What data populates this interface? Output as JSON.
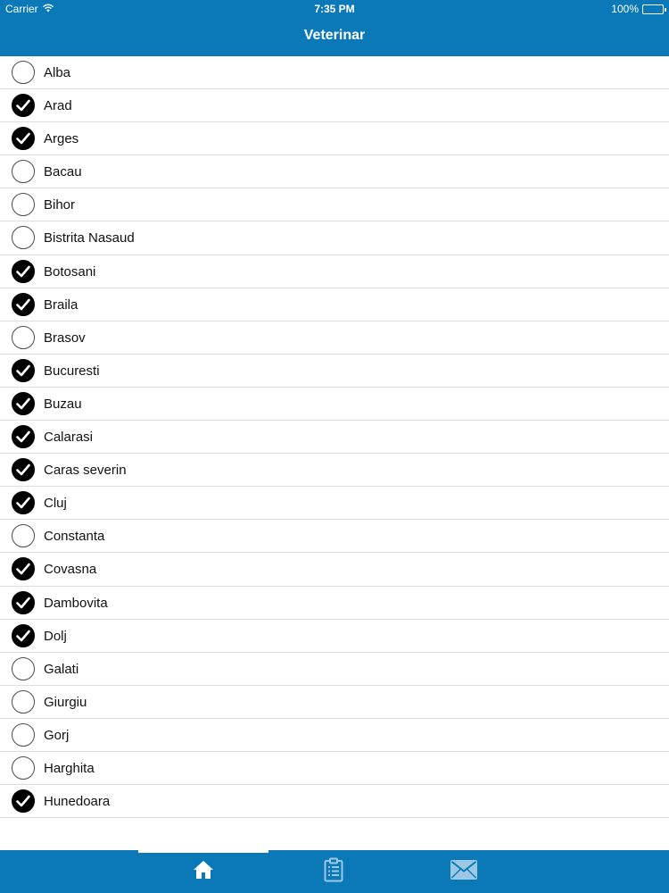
{
  "status_bar": {
    "carrier": "Carrier",
    "time": "7:35 PM",
    "battery": "100%"
  },
  "nav": {
    "title": "Veterinar"
  },
  "counties": [
    {
      "name": "Alba",
      "checked": false
    },
    {
      "name": "Arad",
      "checked": true
    },
    {
      "name": "Arges",
      "checked": true
    },
    {
      "name": "Bacau",
      "checked": false
    },
    {
      "name": "Bihor",
      "checked": false
    },
    {
      "name": "Bistrita Nasaud",
      "checked": false
    },
    {
      "name": "Botosani",
      "checked": true
    },
    {
      "name": "Braila",
      "checked": true
    },
    {
      "name": "Brasov",
      "checked": false
    },
    {
      "name": "Bucuresti",
      "checked": true
    },
    {
      "name": "Buzau",
      "checked": true
    },
    {
      "name": "Calarasi",
      "checked": true
    },
    {
      "name": "Caras severin",
      "checked": true
    },
    {
      "name": "Cluj",
      "checked": true
    },
    {
      "name": "Constanta",
      "checked": false
    },
    {
      "name": "Covasna",
      "checked": true
    },
    {
      "name": "Dambovita",
      "checked": true
    },
    {
      "name": "Dolj",
      "checked": true
    },
    {
      "name": "Galati",
      "checked": false
    },
    {
      "name": "Giurgiu",
      "checked": false
    },
    {
      "name": "Gorj",
      "checked": false
    },
    {
      "name": "Harghita",
      "checked": false
    },
    {
      "name": "Hunedoara",
      "checked": true
    }
  ],
  "tabs": [
    {
      "icon": "home-icon",
      "selected": true
    },
    {
      "icon": "clipboard-icon",
      "selected": false
    },
    {
      "icon": "mail-icon",
      "selected": false
    }
  ],
  "colors": {
    "brand_blue": "#0b79b8",
    "check_on": "#000000",
    "divider": "#dedede"
  }
}
